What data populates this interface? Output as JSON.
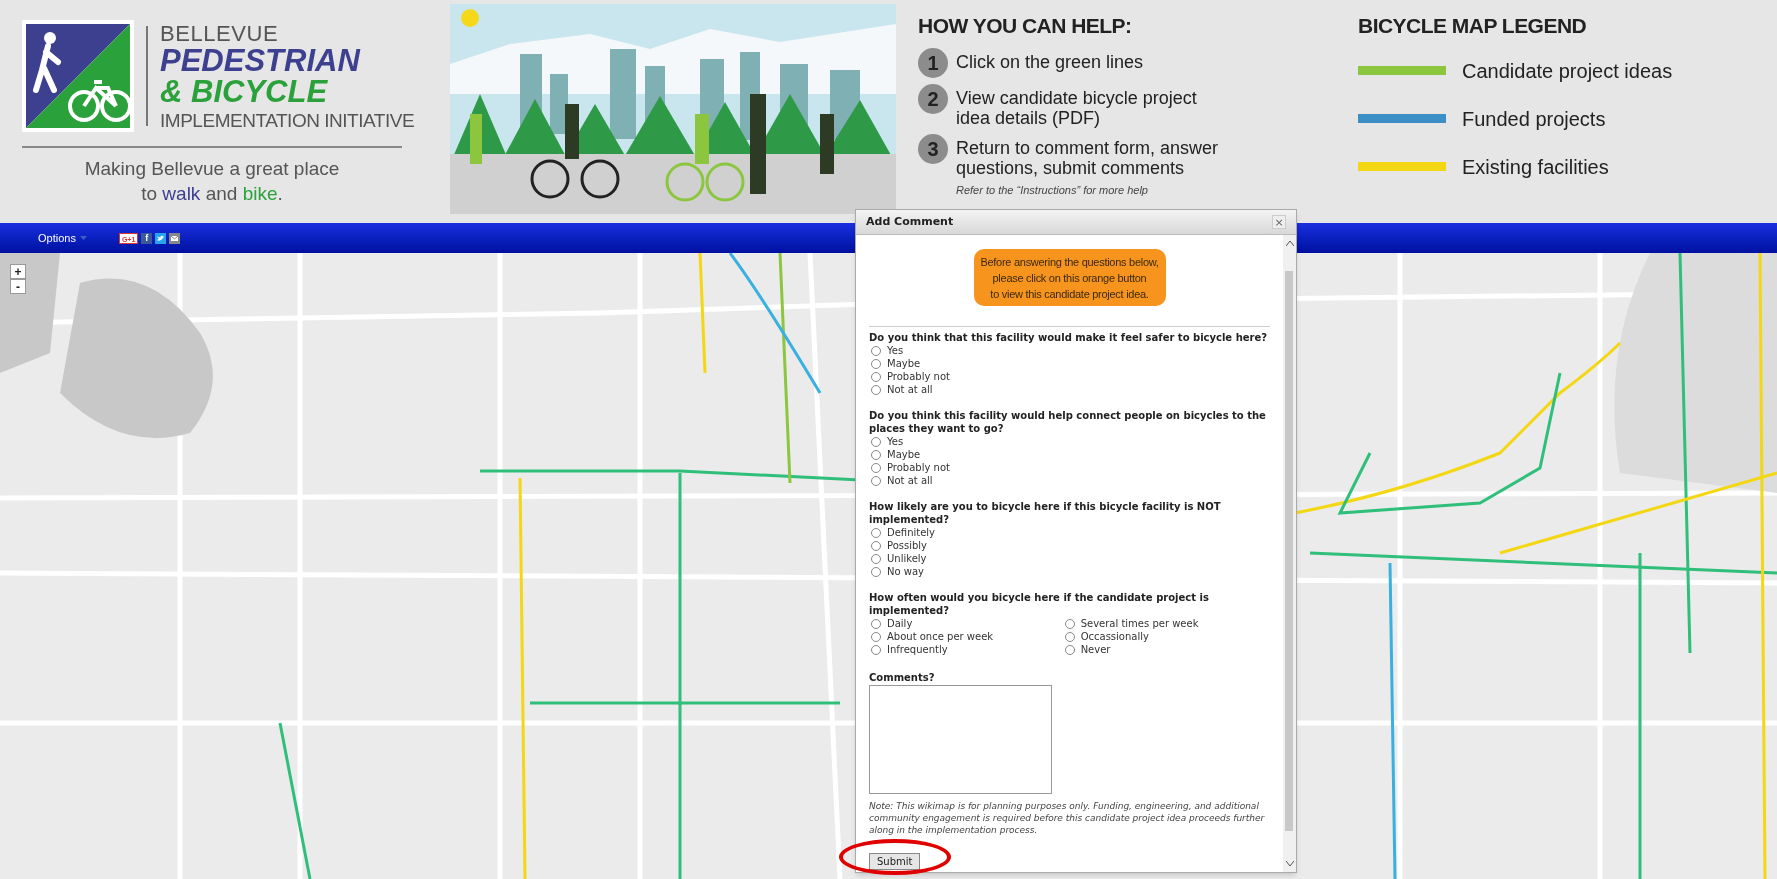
{
  "header": {
    "logo_lines": [
      "BELLEVUE",
      "PEDESTRIAN",
      "& BICYCLE",
      "IMPLEMENTATION INITIATIVE"
    ],
    "tagline": [
      {
        "text": "Making Bellevue a great place to ",
        "kind": "plain"
      },
      {
        "text": "walk",
        "kind": "walk"
      },
      {
        "text": " and ",
        "kind": "plain"
      },
      {
        "text": "bike",
        "kind": "bike"
      },
      {
        "text": ".",
        "kind": "plain"
      }
    ]
  },
  "help": {
    "title": "HOW YOU CAN HELP:",
    "steps": [
      {
        "number": "1",
        "text": "Click on the green lines"
      },
      {
        "number": "2",
        "text": "View candidate bicycle project idea details (PDF)"
      },
      {
        "number": "3",
        "text": "Return to comment form, answer questions, submit comments"
      }
    ],
    "note": "Refer to the “Instructions” for more help"
  },
  "legend": {
    "title": "BICYCLE MAP LEGEND",
    "items": [
      {
        "label": "Candidate project ideas",
        "color": "#8cc63f"
      },
      {
        "label": "Funded projects",
        "color": "#3b8fc4"
      },
      {
        "label": "Existing facilities",
        "color": "#f4d713"
      }
    ]
  },
  "toolbar": {
    "menu": "Options",
    "share": [
      {
        "kind": "google",
        "label": "G+1"
      },
      {
        "kind": "facebook",
        "label": "f"
      },
      {
        "kind": "twitter"
      },
      {
        "kind": "email"
      }
    ]
  },
  "map_controls": [
    "+",
    "-"
  ],
  "dialog": {
    "title": "Add Comment",
    "close": "×",
    "project_button": "Before answering the questions below,\nplease click on this orange button\nto view this candidate project idea.",
    "questions": [
      {
        "text": "Do you think that this facility would make it feel safer to bicycle here?",
        "kind": "single",
        "options": [
          {
            "label": "Yes",
            "selected": false
          },
          {
            "label": "Maybe",
            "selected": false
          },
          {
            "label": "Probably not",
            "selected": false
          },
          {
            "label": "Not at all",
            "selected": false
          }
        ]
      },
      {
        "text": "Do you think this facility would help connect people on bicycles to the places they want to go?",
        "kind": "single",
        "options": [
          {
            "label": "Yes",
            "selected": false
          },
          {
            "label": "Maybe",
            "selected": false
          },
          {
            "label": "Probably not",
            "selected": false
          },
          {
            "label": "Not at all",
            "selected": false
          }
        ]
      },
      {
        "text": "How likely are you to bicycle here if this bicycle facility is NOT implemented?",
        "kind": "single",
        "options": [
          {
            "label": "Definitely",
            "selected": false
          },
          {
            "label": "Possibly",
            "selected": false
          },
          {
            "label": "Unlikely",
            "selected": false
          },
          {
            "label": "No way",
            "selected": false
          }
        ]
      },
      {
        "text": "How often would you bicycle here if the candidate project is implemented?",
        "kind": "grid",
        "options": [
          {
            "label": "Daily",
            "selected": false
          },
          {
            "label": "About once per week",
            "selected": false
          },
          {
            "label": "Infrequently",
            "selected": false
          },
          {
            "label": "Several times per week",
            "selected": false
          },
          {
            "label": "Occassionally",
            "selected": false
          },
          {
            "label": "Never",
            "selected": false
          }
        ]
      }
    ],
    "comments_label": "Comments?",
    "note": "Note: This wikimap is for planning purposes only. Funding, engineering, and additional community engagement is required before this candidate project idea proceeds further along in the implementation process.",
    "submit": "Submit"
  }
}
